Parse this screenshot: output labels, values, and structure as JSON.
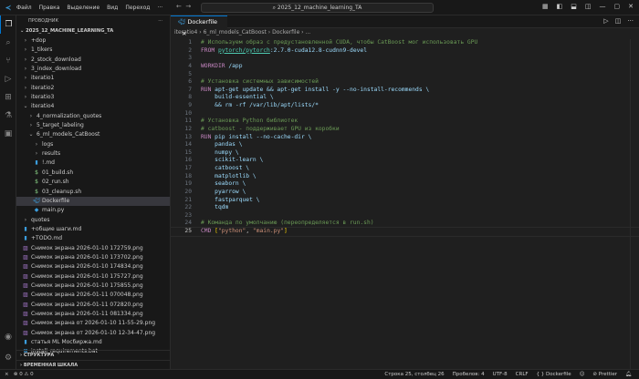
{
  "titlebar": {
    "menu": [
      "Файл",
      "Правка",
      "Выделение",
      "Вид",
      "Переход",
      "···"
    ],
    "search": "2025_12_machine_learning_TA"
  },
  "sidebar": {
    "header": "ПРОВОДНИК",
    "root": "2025_12_MACHINE_LEARNING_TA",
    "items": [
      {
        "label": "+dop",
        "type": "folder",
        "open": false,
        "depth": 0
      },
      {
        "label": "1_tikers",
        "type": "folder",
        "open": false,
        "depth": 0
      },
      {
        "label": "2_stock_download",
        "type": "folder",
        "open": false,
        "depth": 0
      },
      {
        "label": "3_index_download",
        "type": "folder",
        "open": false,
        "depth": 0
      },
      {
        "label": "iteratio1",
        "type": "folder",
        "open": false,
        "depth": 0
      },
      {
        "label": "iteratio2",
        "type": "folder",
        "open": false,
        "depth": 0
      },
      {
        "label": "iteratio3",
        "type": "folder",
        "open": false,
        "depth": 0
      },
      {
        "label": "iteratio4",
        "type": "folder",
        "open": true,
        "depth": 0
      },
      {
        "label": "4_normalization_quotes",
        "type": "folder",
        "open": false,
        "depth": 1
      },
      {
        "label": "5_target_labeling",
        "type": "folder",
        "open": false,
        "depth": 1
      },
      {
        "label": "6_ml_models_CatBoost",
        "type": "folder",
        "open": true,
        "depth": 1
      },
      {
        "label": "logs",
        "type": "folder",
        "open": false,
        "depth": 2
      },
      {
        "label": "results",
        "type": "folder",
        "open": false,
        "depth": 2
      },
      {
        "label": "!.md",
        "type": "md",
        "depth": 2
      },
      {
        "label": "01_build.sh",
        "type": "sh",
        "depth": 2
      },
      {
        "label": "02_run.sh",
        "type": "sh",
        "depth": 2
      },
      {
        "label": "03_cleanup.sh",
        "type": "sh",
        "depth": 2
      },
      {
        "label": "Dockerfile",
        "type": "docker",
        "depth": 2,
        "selected": true
      },
      {
        "label": "main.py",
        "type": "py",
        "depth": 2
      },
      {
        "label": "quotes",
        "type": "folder",
        "open": false,
        "depth": 0
      },
      {
        "label": "+общие шаги.md",
        "type": "md",
        "depth": 0
      },
      {
        "label": "+TODO.md",
        "type": "md",
        "depth": 0
      },
      {
        "label": "Снимок экрана 2026-01-10 172759.png",
        "type": "png",
        "depth": 0
      },
      {
        "label": "Снимок экрана 2026-01-10 173702.png",
        "type": "png",
        "depth": 0
      },
      {
        "label": "Снимок экрана 2026-01-10 174834.png",
        "type": "png",
        "depth": 0
      },
      {
        "label": "Снимок экрана 2026-01-10 175727.png",
        "type": "png",
        "depth": 0
      },
      {
        "label": "Снимок экрана 2026-01-10 175855.png",
        "type": "png",
        "depth": 0
      },
      {
        "label": "Снимок экрана 2026-01-11 070048.png",
        "type": "png",
        "depth": 0
      },
      {
        "label": "Снимок экрана 2026-01-11 072820.png",
        "type": "png",
        "depth": 0
      },
      {
        "label": "Снимок экрана 2026-01-11 081334.png",
        "type": "png",
        "depth": 0
      },
      {
        "label": "Снимок экрана от 2026-01-10 11-55-29.png",
        "type": "png",
        "depth": 0
      },
      {
        "label": "Снимок экрана от 2026-01-10 12-34-47.png",
        "type": "png",
        "depth": 0
      },
      {
        "label": "статья ML Мосбиржа.md",
        "type": "md",
        "depth": 0
      },
      {
        "label": "install_requirements.bat",
        "type": "bat",
        "depth": 0
      }
    ],
    "sections": [
      "СТРУКТУРА",
      "ВРЕМЕННАЯ ШКАЛА"
    ]
  },
  "editor": {
    "tab": "Dockerfile",
    "breadcrumb": [
      "iteratio4",
      "6_ml_models_CatBoost",
      "Dockerfile",
      "..."
    ],
    "lines": [
      [
        [
          "c",
          "# Используем образ с предустановленной CUDA, чтобы CatBoost мог использовать GPU"
        ]
      ],
      [
        [
          "k",
          "FROM "
        ],
        [
          "img",
          "pytorch/pytorch"
        ],
        [
          "a",
          ":2.7.0-cuda12.8-cudnn9-devel"
        ]
      ],
      [],
      [
        [
          "k",
          "WORKDIR "
        ],
        [
          "a",
          "/app"
        ]
      ],
      [],
      [
        [
          "c",
          "# Установка системных зависимостей"
        ]
      ],
      [
        [
          "k",
          "RUN "
        ],
        [
          "a",
          "apt-get update && apt-get install -y --no-install-recommends \\"
        ]
      ],
      [
        [
          "a",
          "    build-essential \\"
        ]
      ],
      [
        [
          "a",
          "    && rm -rf /var/lib/apt/lists/*"
        ]
      ],
      [],
      [
        [
          "c",
          "# Установка Python библиотек"
        ]
      ],
      [
        [
          "c",
          "# catboost - поддерживает GPU из коробки"
        ]
      ],
      [
        [
          "k",
          "RUN "
        ],
        [
          "a",
          "pip install --no-cache-dir \\"
        ]
      ],
      [
        [
          "a",
          "    pandas \\"
        ]
      ],
      [
        [
          "a",
          "    numpy \\"
        ]
      ],
      [
        [
          "a",
          "    scikit-learn \\"
        ]
      ],
      [
        [
          "a",
          "    catboost \\"
        ]
      ],
      [
        [
          "a",
          "    matplotlib \\"
        ]
      ],
      [
        [
          "a",
          "    seaborn \\"
        ]
      ],
      [
        [
          "a",
          "    pyarrow \\"
        ]
      ],
      [
        [
          "a",
          "    fastparquet \\"
        ]
      ],
      [
        [
          "a",
          "    tqdm"
        ]
      ],
      [],
      [
        [
          "c",
          "# Команда по умолчанию (переопределяется в run.sh)"
        ]
      ],
      [
        [
          "k",
          "CMD "
        ],
        [
          "b",
          "["
        ],
        [
          "s",
          "\"python\""
        ],
        [
          "t",
          ", "
        ],
        [
          "s",
          "\"main.py\""
        ],
        [
          "b",
          "]"
        ]
      ]
    ],
    "current_line": 25
  },
  "status": {
    "errors": "0",
    "warnings": "0",
    "position": "Строка 25, столбец 26",
    "spaces": "Пробелов: 4",
    "encoding": "UTF-8",
    "eol": "CRLF",
    "language": "Dockerfile",
    "prettier": "Prettier"
  }
}
